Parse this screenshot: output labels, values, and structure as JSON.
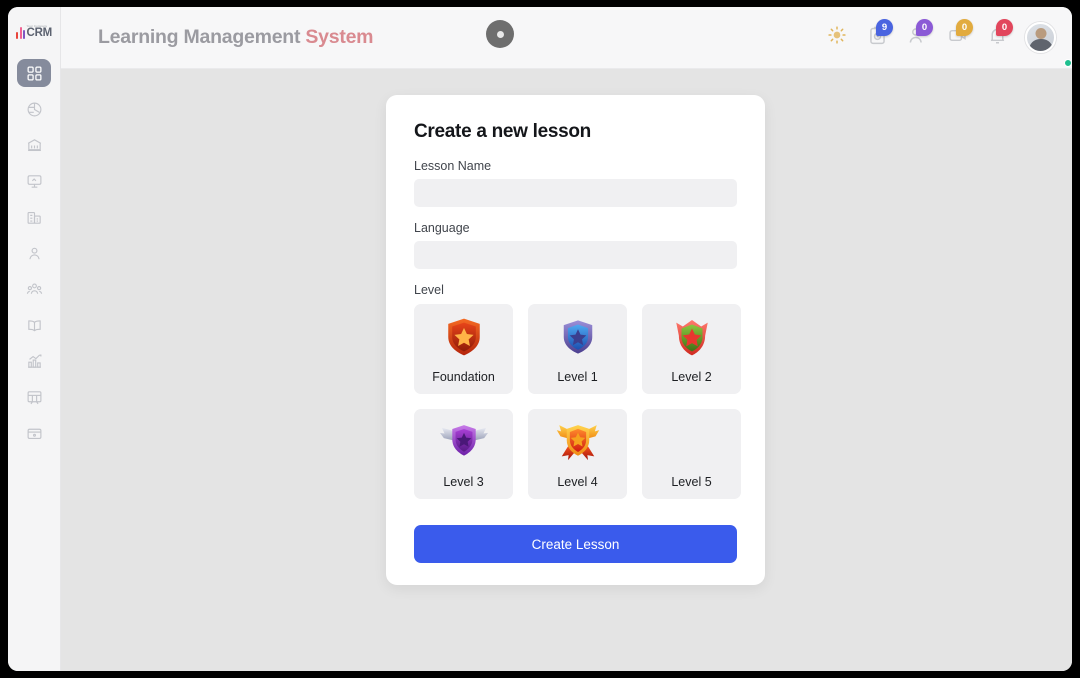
{
  "window": {
    "frame_color": "#000000",
    "page_bg": "#e4e4e4"
  },
  "sidebar": {
    "logo": {
      "top_text": "Your Company",
      "main_text": "CRM"
    },
    "items": [
      {
        "name": "dashboard",
        "icon": "grid-dashboard-icon",
        "active": true
      },
      {
        "name": "analytics",
        "icon": "globe-pie-icon",
        "active": false
      },
      {
        "name": "bank",
        "icon": "bank-building-icon",
        "active": false
      },
      {
        "name": "presentation",
        "icon": "presentation-board-icon",
        "active": false
      },
      {
        "name": "companies",
        "icon": "office-buildings-icon",
        "active": false
      },
      {
        "name": "contacts",
        "icon": "person-icon",
        "active": false
      },
      {
        "name": "teams",
        "icon": "people-group-icon",
        "active": false
      },
      {
        "name": "lessons",
        "icon": "open-book-icon",
        "active": false
      },
      {
        "name": "reports",
        "icon": "bar-chart-growth-icon",
        "active": false
      },
      {
        "name": "projects",
        "icon": "kanban-board-icon",
        "active": false
      },
      {
        "name": "archive",
        "icon": "briefcase-box-icon",
        "active": false
      }
    ]
  },
  "header": {
    "title_main": "Learning Management",
    "title_accent": "System",
    "camera_notch": "webcam-indicator",
    "actions": [
      {
        "name": "theme-toggle",
        "icon": "sun-icon",
        "badge": null,
        "badge_color": null
      },
      {
        "name": "tasks",
        "icon": "clipboard-clock-icon",
        "badge": "9",
        "badge_color": "#4a64e0"
      },
      {
        "name": "contacts",
        "icon": "user-add-icon",
        "badge": "0",
        "badge_color": "#8b5ad6"
      },
      {
        "name": "meetings",
        "icon": "video-camera-icon",
        "badge": "0",
        "badge_color": "#e2ab3f"
      },
      {
        "name": "notifications",
        "icon": "bell-icon",
        "badge": "0",
        "badge_color": "#e2465c"
      }
    ],
    "avatar": {
      "name": "user-avatar",
      "status": "online",
      "status_color": "#1fbf8f"
    }
  },
  "card": {
    "title": "Create a new lesson",
    "fields": [
      {
        "label": "Lesson Name",
        "value": "",
        "placeholder": ""
      },
      {
        "label": "Language",
        "value": "",
        "placeholder": ""
      }
    ],
    "level_label": "Level",
    "levels": [
      {
        "label": "Foundation",
        "icon": "shield-star-badge-orange",
        "colors": {
          "outer": "#e84a1c",
          "inner": "#c62f10",
          "star": "#ffb347"
        },
        "winged": false,
        "has_art": true
      },
      {
        "label": "Level 1",
        "icon": "shield-star-badge-blue",
        "colors": {
          "outer": "#7b6fc4",
          "inner": "#2f7fe0",
          "star": "#3b3f8f"
        },
        "winged": false,
        "has_art": true
      },
      {
        "label": "Level 2",
        "icon": "shield-star-badge-red-green",
        "colors": {
          "outer": "#ef4a4a",
          "inner": "#5a8a2a",
          "star": "#e8372f"
        },
        "winged": false,
        "has_art": true
      },
      {
        "label": "Level 3",
        "icon": "winged-shield-badge-purple",
        "colors": {
          "outer": "#b9bed2",
          "inner": "#8e2fd0",
          "star": "#5c1f8c"
        },
        "winged": true,
        "has_art": true
      },
      {
        "label": "Level 4",
        "icon": "winged-shield-badge-orange",
        "colors": {
          "outer": "#f7b733",
          "inner": "#e8321e",
          "star": "#f6a21e"
        },
        "winged": true,
        "has_art": true
      },
      {
        "label": "Level 5",
        "icon": "none",
        "colors": null,
        "winged": false,
        "has_art": false
      }
    ],
    "submit_label": "Create Lesson",
    "submit_color": "#3a5bec"
  }
}
